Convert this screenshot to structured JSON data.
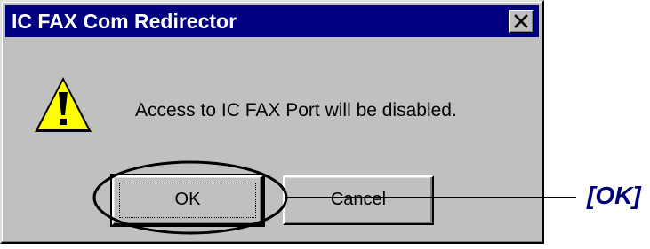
{
  "dialog": {
    "title": "IC FAX Com Redirector",
    "close_symbol": "X",
    "icon": "warning-icon",
    "message": "Access to IC FAX Port will be disabled.",
    "buttons": {
      "ok_label": "OK",
      "cancel_label": "Cancel"
    }
  },
  "annotation": {
    "label": "[OK]"
  },
  "colors": {
    "titlebar": "#000080",
    "dialog_bg": "#c0c0c0",
    "warning_yellow": "#ffff00",
    "callout_text": "#00007a"
  }
}
